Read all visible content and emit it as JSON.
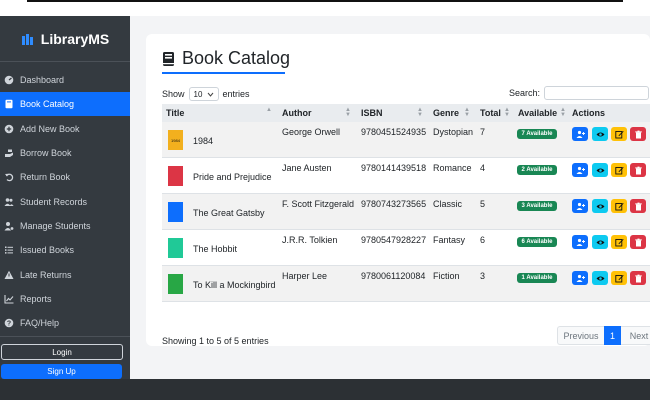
{
  "brand": {
    "name": "LibraryMS",
    "icon": "books-icon"
  },
  "sidebar": {
    "items": [
      {
        "label": "Dashboard",
        "icon": "dashboard-icon",
        "active": false
      },
      {
        "label": "Book Catalog",
        "icon": "book-icon",
        "active": true
      },
      {
        "label": "Add New Book",
        "icon": "plus-circle-icon",
        "active": false
      },
      {
        "label": "Borrow Book",
        "icon": "hand-icon",
        "active": false
      },
      {
        "label": "Return Book",
        "icon": "undo-icon",
        "active": false
      },
      {
        "label": "Student Records",
        "icon": "users-icon",
        "active": false
      },
      {
        "label": "Manage Students",
        "icon": "user-gear-icon",
        "active": false
      },
      {
        "label": "Issued Books",
        "icon": "list-icon",
        "active": false
      },
      {
        "label": "Late Returns",
        "icon": "warning-icon",
        "active": false
      },
      {
        "label": "Reports",
        "icon": "chart-icon",
        "active": false
      },
      {
        "label": "FAQ/Help",
        "icon": "help-icon",
        "active": false
      }
    ],
    "login_label": "Login",
    "signup_label": "Sign Up"
  },
  "main": {
    "title": "Book Catalog",
    "show_label": "Show",
    "entries_value": "10",
    "entries_label": "entries",
    "search_label": "Search:",
    "columns": [
      "Title",
      "Author",
      "ISBN",
      "Genre",
      "Total",
      "Available",
      "Actions"
    ],
    "books": [
      {
        "title": "1984",
        "author": "George Orwell",
        "isbn": "9780451524935",
        "genre": "Dystopian",
        "total": "7",
        "available": "7 Available",
        "cover_color": "#f2b01e",
        "cover_text": "1984"
      },
      {
        "title": "Pride and Prejudice",
        "author": "Jane Austen",
        "isbn": "9780141439518",
        "genre": "Romance",
        "total": "4",
        "available": "2 Available",
        "cover_color": "#dc3545",
        "cover_text": ""
      },
      {
        "title": "The Great Gatsby",
        "author": "F. Scott Fitzgerald",
        "isbn": "9780743273565",
        "genre": "Classic",
        "total": "5",
        "available": "3 Available",
        "cover_color": "#0d6efd",
        "cover_text": ""
      },
      {
        "title": "The Hobbit",
        "author": "J.R.R. Tolkien",
        "isbn": "9780547928227",
        "genre": "Fantasy",
        "total": "6",
        "available": "6 Available",
        "cover_color": "#20c997",
        "cover_text": ""
      },
      {
        "title": "To Kill a Mockingbird",
        "author": "Harper Lee",
        "isbn": "9780061120084",
        "genre": "Fiction",
        "total": "3",
        "available": "1 Available",
        "cover_color": "#28a745",
        "cover_text": ""
      }
    ],
    "footer": "Showing 1 to 5 of 5 entries",
    "pagination": {
      "previous": "Previous",
      "page": "1",
      "next": "Next"
    }
  },
  "colors": {
    "primary": "#0d6efd",
    "success": "#198754",
    "info": "#0dcaf0",
    "warning": "#ffc107",
    "danger": "#dc3545",
    "sidebar_bg": "#343a40"
  }
}
